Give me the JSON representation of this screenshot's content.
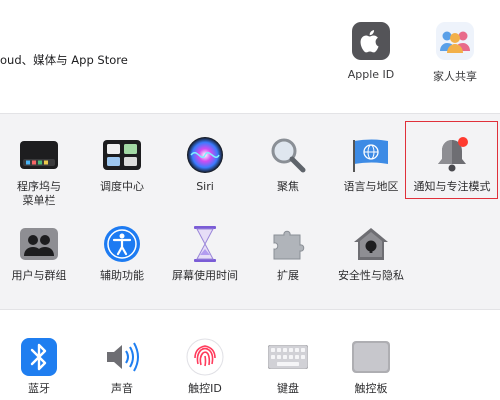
{
  "account": {
    "text": "oud、媒体与 App Store",
    "apple_id_label": "Apple ID",
    "family_label": "家人共享"
  },
  "row1": [
    {
      "label": "程序坞与\n菜单栏",
      "icon": "dock-menubar-icon"
    },
    {
      "label": "调度中心",
      "icon": "mission-control-icon"
    },
    {
      "label": "Siri",
      "icon": "siri-icon"
    },
    {
      "label": "聚焦",
      "icon": "spotlight-icon"
    },
    {
      "label": "语言与地区",
      "icon": "language-region-icon"
    },
    {
      "label": "通知与专注模式",
      "icon": "notifications-icon"
    }
  ],
  "row2": [
    {
      "label": "用户与群组",
      "icon": "users-groups-icon"
    },
    {
      "label": "辅助功能",
      "icon": "accessibility-icon"
    },
    {
      "label": "屏幕使用时间",
      "icon": "screen-time-icon"
    },
    {
      "label": "扩展",
      "icon": "extensions-icon"
    },
    {
      "label": "安全性与隐私",
      "icon": "security-privacy-icon"
    }
  ],
  "row3": [
    {
      "label": "蓝牙",
      "icon": "bluetooth-icon"
    },
    {
      "label": "声音",
      "icon": "sound-icon"
    },
    {
      "label": "触控ID",
      "icon": "touch-id-icon"
    },
    {
      "label": "键盘",
      "icon": "keyboard-icon"
    },
    {
      "label": "触控板",
      "icon": "trackpad-icon"
    }
  ],
  "colors": {
    "highlight_border": "#e0303a",
    "grey_section": "#f3f3f5"
  }
}
